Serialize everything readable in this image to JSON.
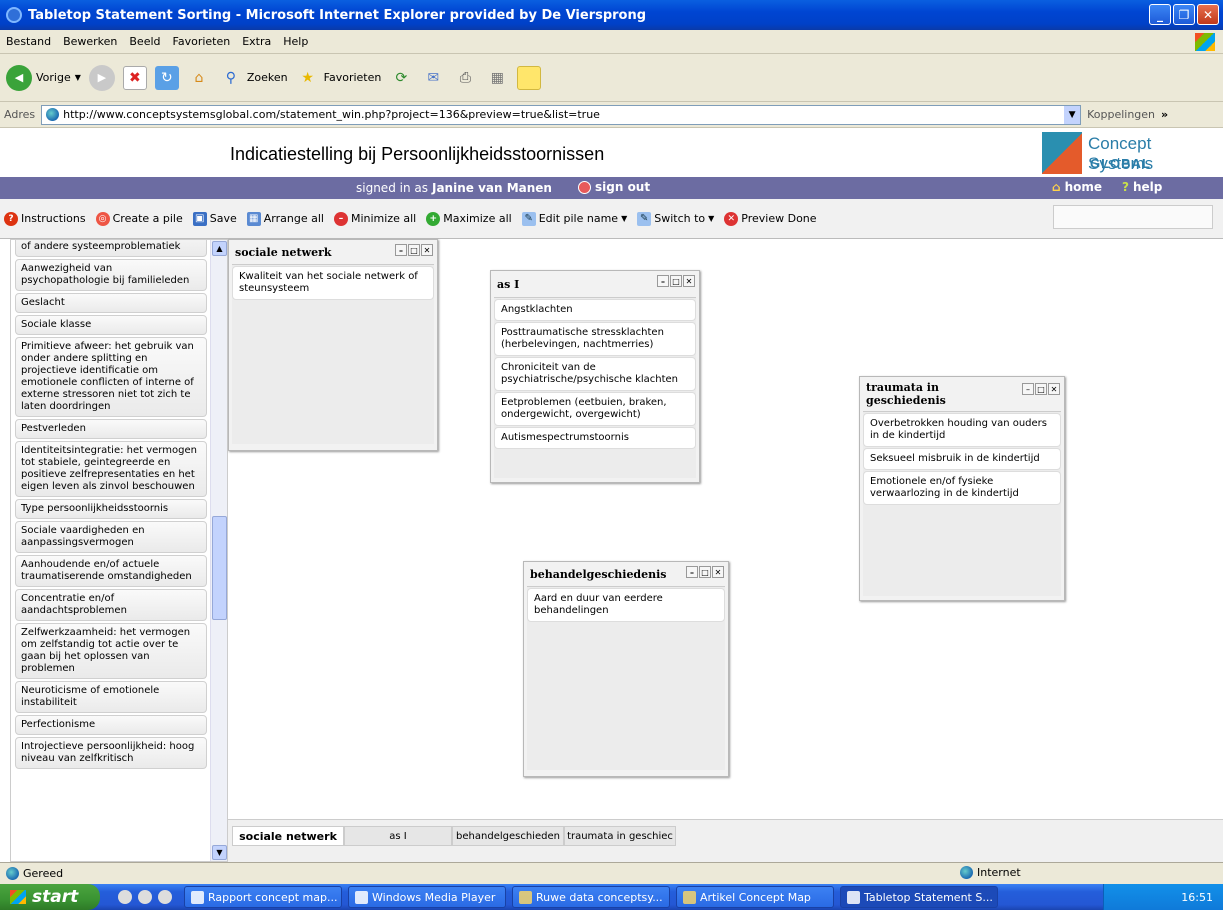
{
  "window": {
    "title": "Tabletop Statement Sorting - Microsoft Internet Explorer provided by De Viersprong"
  },
  "menu": [
    "Bestand",
    "Bewerken",
    "Beeld",
    "Favorieten",
    "Extra",
    "Help"
  ],
  "toolbar": {
    "back": "Vorige",
    "search": "Zoeken",
    "favorites": "Favorieten"
  },
  "address": {
    "label": "Adres",
    "url": "http://www.conceptsystemsglobal.com/statement_win.php?project=136&preview=true&list=true",
    "links": "Koppelingen"
  },
  "page": {
    "title": "Indicatiestelling bij Persoonlijkheidsstoornissen",
    "logo": {
      "line1": "Concept Systems",
      "line2": "GLOBAL"
    },
    "signed_in_prefix": "signed in as",
    "user": "Janine van Manen",
    "sign_out": "sign out",
    "home": "home",
    "help": "help"
  },
  "app_toolbar": [
    "Instructions",
    "Create a pile",
    "Save",
    "Arrange all",
    "Minimize all",
    "Maximize all",
    "Edit pile name",
    "Switch to",
    "Preview Done"
  ],
  "statements": [
    "Aanwezigheid van relatie- / gezins- of andere systeemproblematiek",
    "Aanwezigheid van psychopathologie bij familieleden",
    "Geslacht",
    "Sociale klasse",
    "Primitieve afweer: het gebruik van onder andere splitting en projectieve identificatie om emotionele conflicten of interne of externe stressoren niet tot zich te laten doordringen",
    "Pestverleden",
    "Identiteitsintegratie: het vermogen tot stabiele, geintegreerde en positieve zelfrepresentaties en het eigen leven als zinvol beschouwen",
    "Type persoonlijkheidsstoornis",
    "Sociale vaardigheden en aanpassingsvermogen",
    "Aanhoudende en/of actuele traumatiserende omstandigheden",
    "Concentratie en/of aandachtsproblemen",
    "Zelfwerkzaamheid: het vermogen om zelfstandig tot actie over te gaan bij het oplossen van problemen",
    "Neuroticisme of emotionele instabiliteit",
    "Perfectionisme",
    "Introjectieve persoonlijkheid: hoog niveau van zelfkritisch"
  ],
  "piles": [
    {
      "name": "sociale netwerk",
      "items": [
        "Kwaliteit van het sociale netwerk of steunsysteem"
      ]
    },
    {
      "name": "as I",
      "items": [
        "Angstklachten",
        "Posttraumatische stressklachten (herbelevingen, nachtmerries)",
        "Chroniciteit van de psychiatrische/psychische klachten",
        "Eetproblemen (eetbuien, braken, ondergewicht, overgewicht)",
        "Autismespectrumstoornis"
      ]
    },
    {
      "name": "behandelgeschiedenis",
      "items": [
        "Aard en duur van eerdere behandelingen"
      ]
    },
    {
      "name": "traumata in geschiedenis",
      "items": [
        "Overbetrokken houding van ouders in de kindertijd",
        "Seksueel misbruik in de kindertijd",
        "Emotionele en/of fysieke verwaarlozing in de kindertijd"
      ]
    }
  ],
  "tabs": [
    "sociale netwerk",
    "as I",
    "behandelgeschieden",
    "traumata in geschiec"
  ],
  "status": {
    "text": "Gereed",
    "zone": "Internet"
  },
  "taskbar": {
    "start": "start",
    "tasks": [
      "Rapport concept map...",
      "Windows Media Player",
      "Ruwe data conceptsy...",
      "Artikel Concept Map",
      "Tabletop Statement S..."
    ],
    "clock": "16:51"
  }
}
